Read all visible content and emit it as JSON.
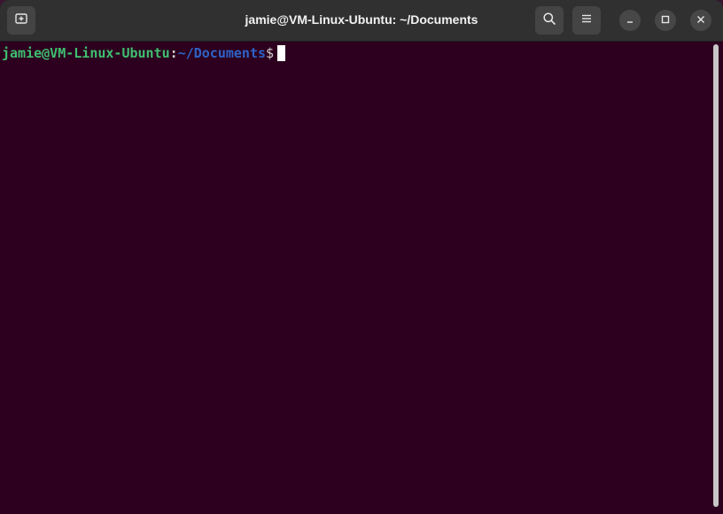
{
  "window": {
    "title": "jamie@VM-Linux-Ubuntu: ~/Documents"
  },
  "header": {
    "new_tab_icon": "new-tab-icon",
    "search_icon": "search-icon",
    "menu_icon": "hamburger-menu-icon"
  },
  "window_controls": {
    "minimize_icon": "minimize-icon",
    "maximize_icon": "maximize-icon",
    "close_icon": "close-icon"
  },
  "terminal": {
    "prompt_user_host": "jamie@VM-Linux-Ubuntu",
    "prompt_separator": ":",
    "prompt_path": "~/Documents",
    "prompt_symbol": "$"
  },
  "colors": {
    "terminal_background": "#2c001e",
    "titlebar_background": "#303030",
    "prompt_user_color": "#3fbf70",
    "prompt_path_color": "#2e62c6",
    "text_color": "#d0cfcc"
  }
}
